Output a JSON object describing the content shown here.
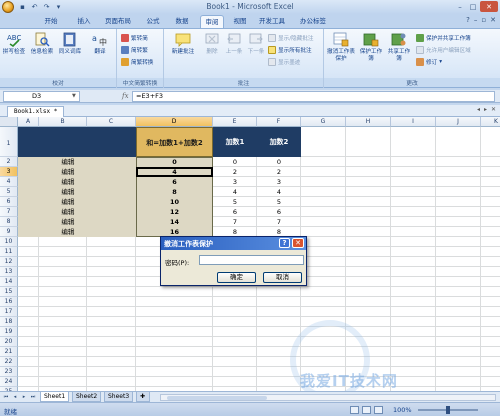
{
  "window": {
    "title": "Book1 - Microsoft Excel"
  },
  "tabs": [
    "开始",
    "插入",
    "页面布局",
    "公式",
    "数据",
    "审阅",
    "视图",
    "开发工具",
    "办公标签"
  ],
  "active_tab": "审阅",
  "ribbon": {
    "groups": {
      "proofing": "校对",
      "cn_convert": "中文简繁转换",
      "comments": "批注",
      "changes": "更改"
    },
    "buttons": {
      "spelling": "拼写检查",
      "research": "信息检索",
      "thesaurus": "同义词库",
      "translate": "翻译",
      "to_simplified": "繁转简",
      "to_traditional": "简转繁",
      "cn_convert": "简繁转换",
      "new_comment": "新建批注",
      "delete": "删除",
      "previous": "上一条",
      "next": "下一条",
      "show_hide_comment": "显示/隐藏批注",
      "show_all_comments": "显示所有批注",
      "show_ink": "显示墨迹",
      "unprotect_sheet": "撤消工作表保护",
      "protect_workbook": "保护工作簿",
      "share_workbook": "共享工作簿",
      "protect_share": "保护并共享工作簿",
      "allow_edit_ranges": "允许用户编辑区域",
      "track_changes": "修订"
    }
  },
  "formula_bar": {
    "name_box": "D3",
    "fx": "fx",
    "formula": "=E3+F3"
  },
  "workbook_tab": "Book1.xlsx *",
  "columns": [
    "A",
    "B",
    "C",
    "D",
    "E",
    "F",
    "G",
    "H",
    "I",
    "J",
    "K"
  ],
  "rows": [
    "1",
    "2",
    "3",
    "4",
    "5",
    "6",
    "7",
    "8",
    "9",
    "10",
    "11",
    "12",
    "13",
    "14",
    "15",
    "16",
    "17",
    "18",
    "19",
    "20",
    "21",
    "22",
    "23",
    "24",
    "25",
    "26"
  ],
  "table": {
    "header": {
      "d": "和=加数1+加数2",
      "e": "加数1",
      "f": "加数2"
    },
    "edit_label": "编辑",
    "d_values": [
      "0",
      "4",
      "6",
      "8",
      "10",
      "12",
      "14",
      "16"
    ],
    "e_values": [
      "0",
      "2",
      "3",
      "4",
      "5",
      "6",
      "7",
      "8"
    ],
    "f_values": [
      "0",
      "2",
      "3",
      "4",
      "5",
      "6",
      "7",
      "8"
    ]
  },
  "dialog": {
    "title": "撤消工作表保护",
    "help": "?",
    "close": "✕",
    "password_label": "密码(P):",
    "password_value": "",
    "ok": "确定",
    "cancel": "取消"
  },
  "sheets": [
    "Sheet1",
    "Sheet2",
    "Sheet3"
  ],
  "active_sheet": "Sheet1",
  "status": {
    "ready": "就绪",
    "zoom": "100%"
  },
  "watermark": "我爱IT技术网"
}
